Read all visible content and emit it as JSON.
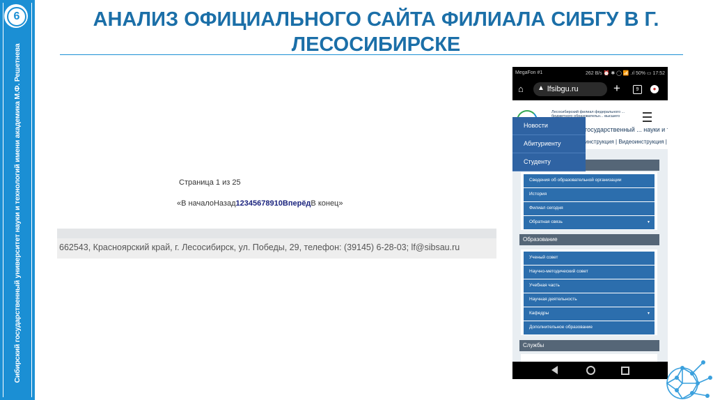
{
  "slide": {
    "number": "6",
    "title": "АНАЛИЗ ОФИЦИАЛЬНОГО САЙТА ФИЛИАЛА СИБГУ В Г. ЛЕСОСИБИРСКЕ",
    "sidebar_text": "Сибирский государственный университет науки и технологий имени академика М.Ф. Решетнева"
  },
  "site_fragment": {
    "page_info": "Страница 1 из 25",
    "pager": {
      "open": "«",
      "first": "В начало",
      "prev": "Назад",
      "pages": [
        "1",
        "2",
        "3",
        "4",
        "5",
        "6",
        "7",
        "8",
        "9",
        "10"
      ],
      "next": "Вперёд",
      "last": "В конец",
      "close": "»"
    },
    "footer_text": "662543, Красноярский край, г. Лесосибирск, ул. Победы, 29, телефон: (39145) 6-28-03; lf@sibsau.ru"
  },
  "phone": {
    "status_left": "MegaFon #1",
    "status_right": "262 B/s ⏰ ✱ ◯ 📶 .ıl 50% ▭ 17:52",
    "url": "lfsibgu.ru",
    "tab_count": "9",
    "header_small": "Лесосибирский филиал федерального ... бюджетного образовательн... высшего образования",
    "header_big": "государственный ... науки и технологий",
    "header_strip": "инструкция | Видеоинструкция | ...образовательной организации",
    "dropdown": [
      "Новости",
      "Абитуриенту",
      "Студенту"
    ],
    "about_items": [
      {
        "label": "Сведения об образовательной организации",
        "caret": false
      },
      {
        "label": "История",
        "caret": false
      },
      {
        "label": "Филиал сегодня",
        "caret": false
      },
      {
        "label": "Обратная связь",
        "caret": true
      }
    ],
    "education_title": "Образование",
    "education_items": [
      {
        "label": "Ученый совет",
        "caret": false
      },
      {
        "label": "Научно-методический совет",
        "caret": false
      },
      {
        "label": "Учебная часть",
        "caret": false
      },
      {
        "label": "Научная деятельность",
        "caret": false
      },
      {
        "label": "Кафедры",
        "caret": true
      },
      {
        "label": "Дополнительное образование",
        "caret": false
      }
    ],
    "services_title": "Службы"
  },
  "colors": {
    "accent": "#1b8fd4",
    "title": "#1b6fa8",
    "menu_item": "#2c6ead",
    "section_bar": "#556677"
  }
}
